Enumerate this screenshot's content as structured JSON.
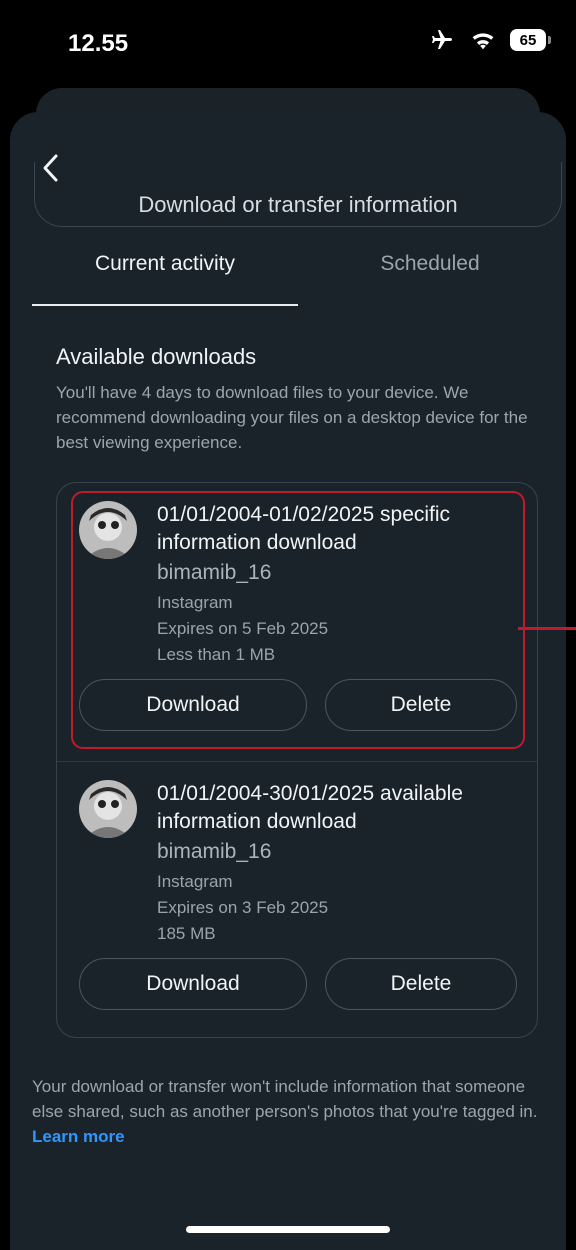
{
  "status_bar": {
    "time": "12.55",
    "battery": "65"
  },
  "header": {
    "partial_title": "Download or transfer information"
  },
  "tabs": [
    {
      "label": "Current activity",
      "active": true
    },
    {
      "label": "Scheduled",
      "active": false
    }
  ],
  "section": {
    "title": "Available downloads",
    "description": "You'll have 4 days to download files to your device. We recommend downloading your files on a desktop device for the best viewing experience."
  },
  "downloads": [
    {
      "title": "01/01/2004-01/02/2025 specific information download",
      "username": "bimamib_16",
      "platform": "Instagram",
      "expires": "Expires on 5 Feb 2025",
      "size": "Less than 1 MB",
      "download_label": "Download",
      "delete_label": "Delete",
      "highlighted": true
    },
    {
      "title": "01/01/2004-30/01/2025 available information download",
      "username": "bimamib_16",
      "platform": "Instagram",
      "expires": "Expires on 3 Feb 2025",
      "size": "185 MB",
      "download_label": "Download",
      "delete_label": "Delete",
      "highlighted": false
    }
  ],
  "footer": {
    "text": "Your download or transfer won't include information that someone else shared, such as another person's photos that you're tagged in.",
    "link": "Learn more"
  },
  "colors": {
    "accent_link": "#2e96ff",
    "highlight": "#c01a2c",
    "sheet_bg": "#1a2329"
  },
  "icons": [
    "airplane-icon",
    "wifi-icon",
    "battery-icon",
    "back-arrow-icon",
    "avatar"
  ]
}
